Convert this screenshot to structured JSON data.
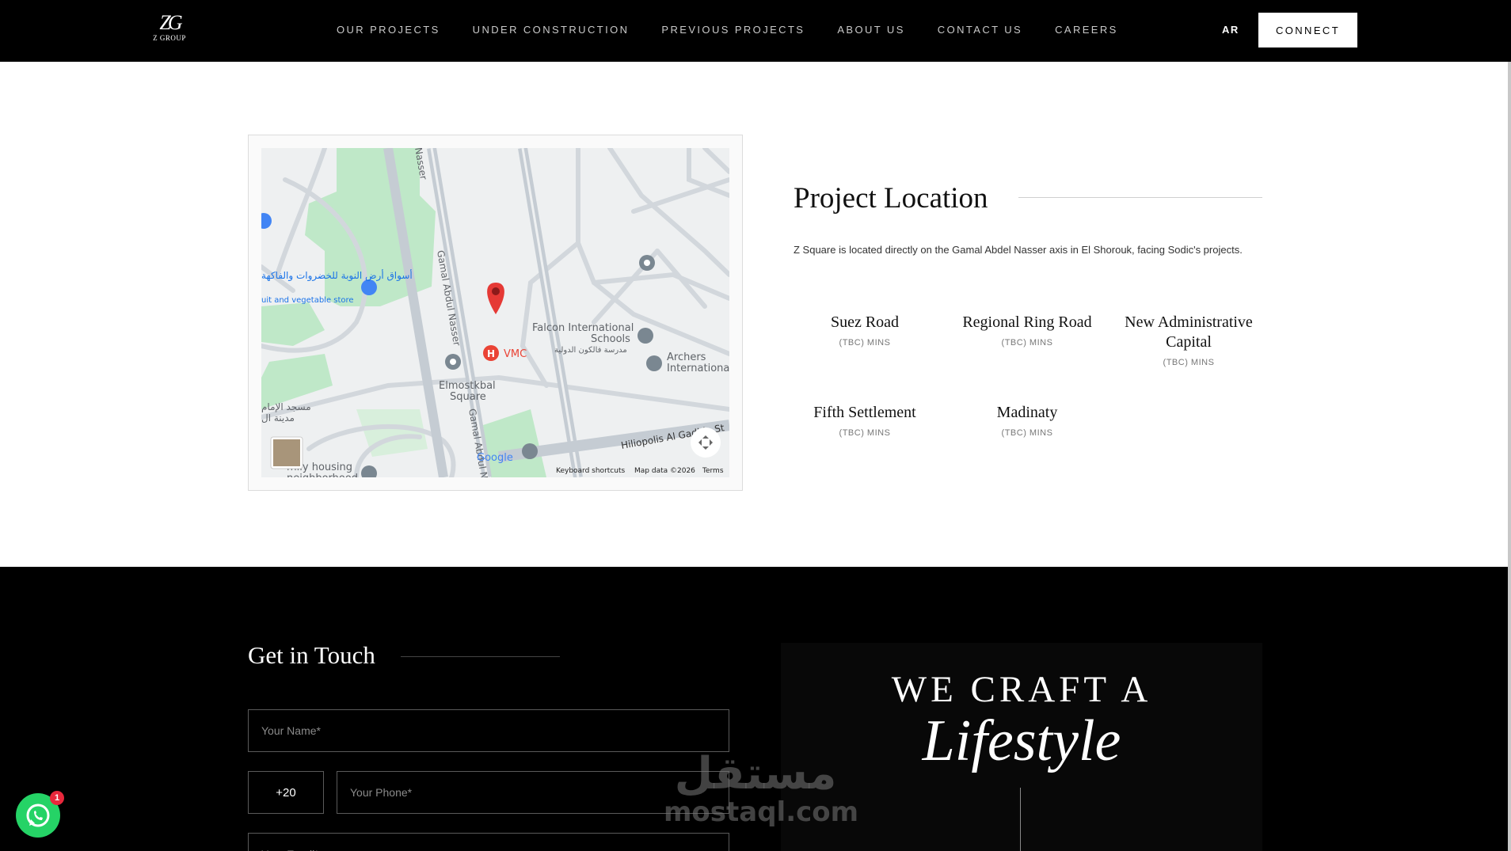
{
  "header": {
    "logo_mark": "ZG",
    "logo_text": "Z GROUP",
    "nav": [
      "OUR PROJECTS",
      "UNDER CONSTRUCTION",
      "PREVIOUS PROJECTS",
      "ABOUT US",
      "CONTACT US",
      "CAREERS"
    ],
    "lang": "AR",
    "connect": "CONNECT"
  },
  "map": {
    "labels": {
      "road_1": "Gamal Abdul Nasser",
      "road_2": "Gamal Abdul Na",
      "road_3": "Nasser",
      "road_4": "Hiliopolis Al Gadida St",
      "store_ar": "أسواق أرض النوبة للخضروات والفاكهة",
      "store_en": "uit and vegetable store",
      "vmc": "VMC",
      "falcon_1": "Falcon International",
      "falcon_2": "Schools",
      "falcon_ar": "مدرسة فالكون الدولية",
      "archers_1": "Archers",
      "archers_2": "International",
      "elmostkbal_1": "Elmostkbal",
      "elmostkbal_2": "Square",
      "mosque_ar": "مسجد الإمام",
      "city_ar": "مدينة ال",
      "family_1": "mily housing",
      "family_2": "neighborhood",
      "google": "Google",
      "kb": "Keyboard shortcuts",
      "data": "Map data ©2026",
      "terms": "Terms"
    }
  },
  "location": {
    "title": "Project Location",
    "description": "Z Square is located directly on the Gamal Abdel Nasser axis in El Shorouk, facing Sodic's projects.",
    "destinations": [
      {
        "name": "Suez Road",
        "time": "(TBC) MINS"
      },
      {
        "name": "Regional Ring Road",
        "time": "(TBC) MINS"
      },
      {
        "name": "New Administrative Capital",
        "time": "(TBC) MINS"
      },
      {
        "name": "Fifth Settlement",
        "time": "(TBC) MINS"
      },
      {
        "name": "Madinaty",
        "time": "(TBC) MINS"
      }
    ]
  },
  "contact": {
    "title": "Get in Touch",
    "name_placeholder": "Your Name*",
    "country_code": "+20",
    "phone_placeholder": "Your Phone*",
    "email_placeholder": "Your Email*"
  },
  "craft": {
    "line1": "WE CRAFT A",
    "line2": "Lifestyle"
  },
  "watermark": {
    "ar": "مستقل",
    "en": "mostaql.com"
  },
  "whatsapp": {
    "badge": "1"
  }
}
